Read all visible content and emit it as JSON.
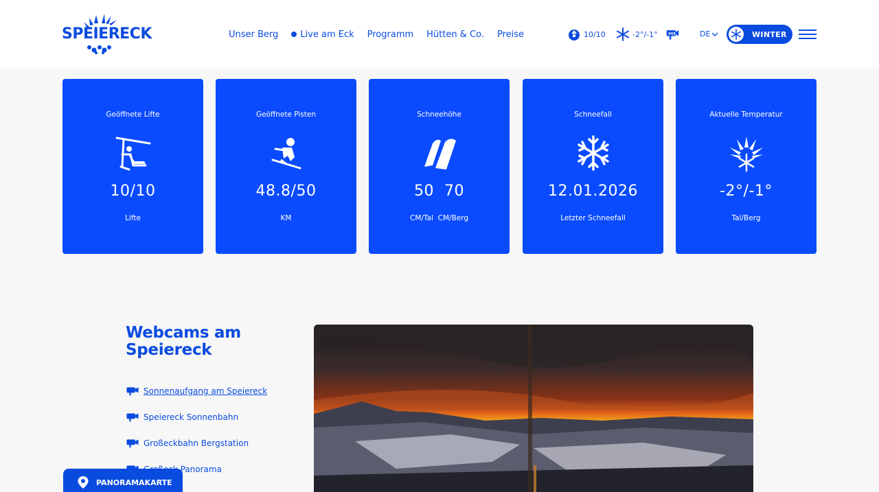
{
  "header": {
    "logo_text": "SPEIERECK",
    "nav": [
      {
        "label": "Unser Berg"
      },
      {
        "label": "Live am Eck",
        "live": true
      },
      {
        "label": "Programm"
      },
      {
        "label": "Hütten & Co."
      },
      {
        "label": "Preise"
      }
    ],
    "status_lifts": "10/10",
    "status_temp": "-2°/-1°",
    "status_webcam_icon": "webcam-icon",
    "language": "DE",
    "season_label": "WINTER"
  },
  "cards": [
    {
      "title": "Geöffnete Lifte",
      "value": "10/10",
      "unit": "Lifte",
      "icon": "chairlift-icon"
    },
    {
      "title": "Geöffnete Pisten",
      "value": "48.8/50",
      "unit": "KM",
      "icon": "skier-icon"
    },
    {
      "title": "Schneehöhe",
      "value": "50  70",
      "unit": "CM/Tal  CM/Berg",
      "icon": "snow-depth-icon"
    },
    {
      "title": "Schneefall",
      "value": "12.01.2026",
      "unit": "Letzter Schneefall",
      "icon": "snowflake-icon"
    },
    {
      "title": "Aktuelle Temperatur",
      "value": "-2°/-1°",
      "unit": "Tal/Berg",
      "icon": "sun-snow-icon"
    }
  ],
  "webcams": {
    "title_line1": "Webcams am",
    "title_line2": "Speiereck",
    "items": [
      {
        "label": "Sonnenaufgang am Speiereck",
        "active": true
      },
      {
        "label": "Speiereck Sonnenbahn"
      },
      {
        "label": "Großeckbahn Bergstation"
      },
      {
        "label": "Großeck Panorama"
      }
    ]
  },
  "panorama_button": "PANORAMAKARTE",
  "colors": {
    "brand": "#0a4bdf",
    "card": "#0a4bff",
    "background": "#f7f7f7"
  }
}
